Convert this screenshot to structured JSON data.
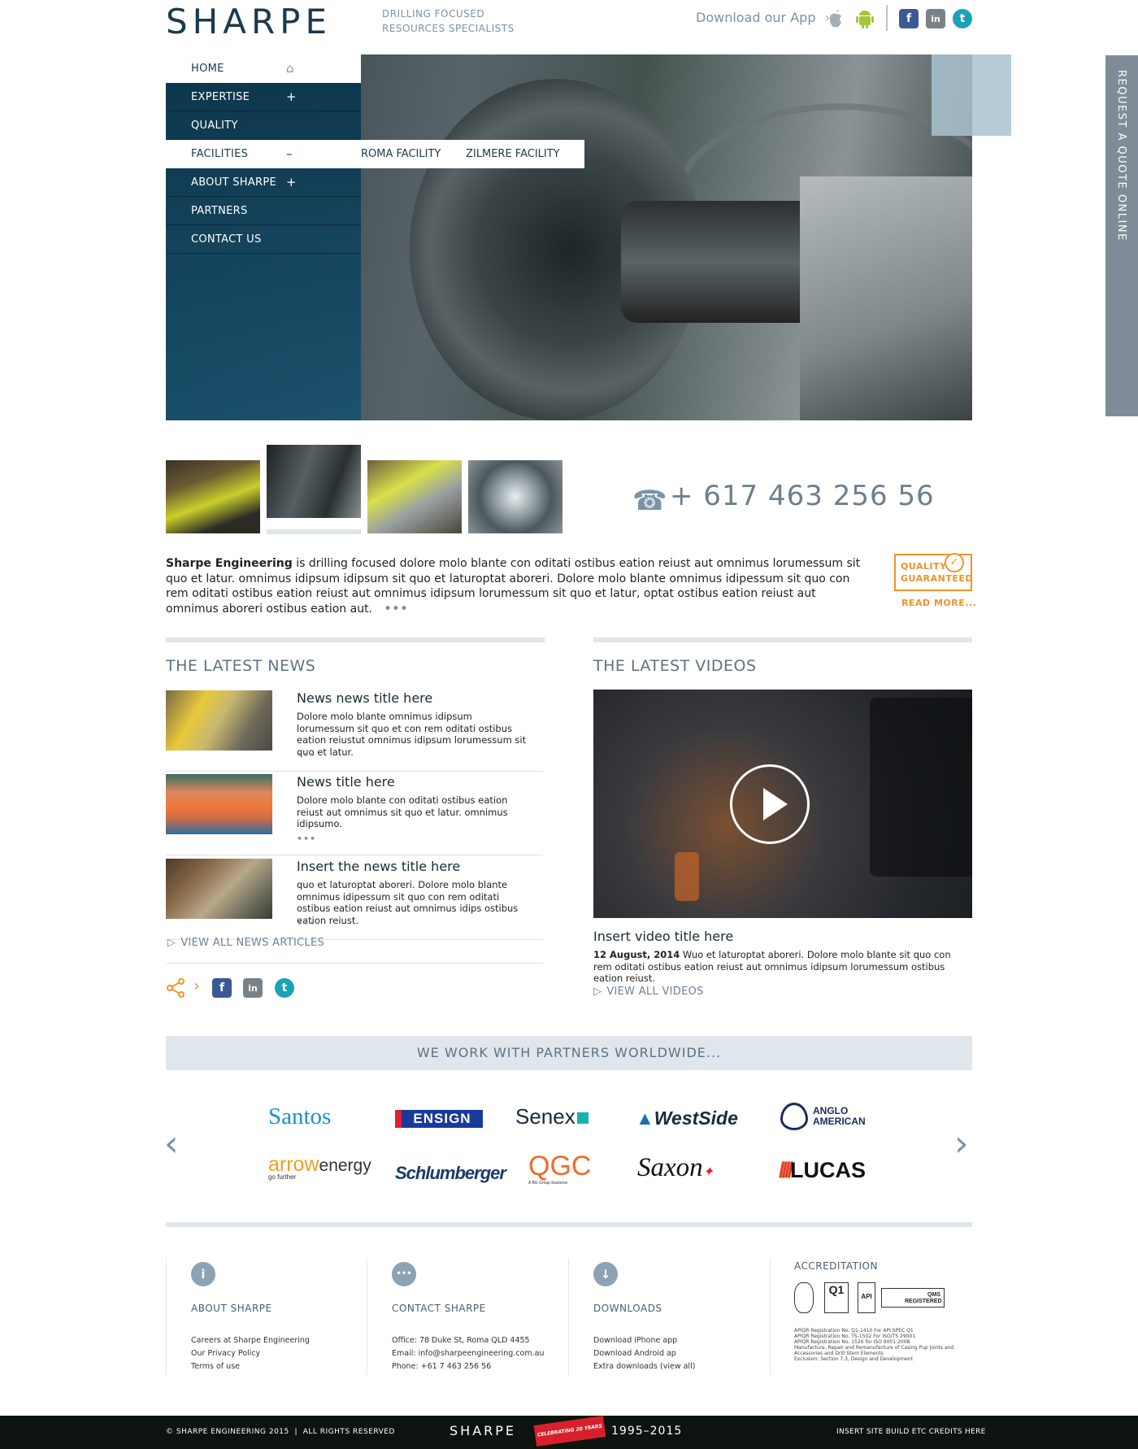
{
  "header": {
    "logo": "SHARPE",
    "tagline_line1": "DRILLING FOCUSED",
    "tagline_line2": "RESOURCES SPECIALISTS",
    "app_link": "Download our App",
    "social": {
      "facebook": "f",
      "linkedin": "in",
      "twitter": "t"
    }
  },
  "nav": {
    "items": [
      {
        "label": "HOME",
        "sign": "⌂"
      },
      {
        "label": "EXPERTISE",
        "sign": "+"
      },
      {
        "label": "QUALITY",
        "sign": ""
      },
      {
        "label": "FACILITIES",
        "sign": "–"
      },
      {
        "label": "ABOUT SHARPE",
        "sign": "+"
      },
      {
        "label": "PARTNERS",
        "sign": ""
      },
      {
        "label": "CONTACT US",
        "sign": ""
      }
    ],
    "subnav": [
      "ROMA FACILITY",
      "ZILMERE FACILITY"
    ]
  },
  "quote_tab": "REQUEST A QUOTE ONLINE",
  "phone": "+ 617 463 256 56",
  "intro": {
    "company": "Sharpe Engineering",
    "text": " is drilling focused dolore molo blante con oditati ostibus eation reiust aut omnimus lorumessum sit quo et latur. omnimus idipsum idipsum sit quo et laturoptat aboreri. Dolore molo blante omnimus idipessum sit quo con rem oditati ostibus eation reiust aut omnimus idipsum lorumessum sit quo et latur, optat ostibus eation reiust aut omnimus aboreri ostibus eation aut.",
    "more": "•••"
  },
  "quality_badge": {
    "line1": "QUALITY",
    "line2": "GUARANTEED",
    "check": "✓",
    "read_more": "READ MORE..."
  },
  "news": {
    "title": "THE LATEST NEWS",
    "items": [
      {
        "title": "News news title here",
        "text": "Dolore molo blante omnimus idipsum lorumessum sit quo et con rem oditati ostibus eation reiustut omnimus idipsum lorumessum sit quo et latur.",
        "more": "•••"
      },
      {
        "title": "News title here",
        "text": "Dolore molo blante con oditati ostibus eation reiust aut omnimus sit quo et latur. omnimus idipsumo.",
        "more": "•••"
      },
      {
        "title": "Insert the news title here",
        "text": "quo et laturoptat aboreri. Dolore molo blante omnimus idipessum sit quo con rem oditati ostibus eation reiust aut omnimus idips ostibus eation reiust.",
        "more": "•••"
      }
    ],
    "view_all": "VIEW ALL NEWS ARTICLES"
  },
  "videos": {
    "title": "THE LATEST VIDEOS",
    "video_title": "Insert video title here",
    "date": "12 August, 2014",
    "text": "Wuo et laturoptat aboreri. Dolore molo blante sit quo con rem oditati ostibus eation reiust aut omnimus idipsum lorumessum ostibus eation reiust.",
    "view_all": "VIEW ALL VIDEOS"
  },
  "partners": {
    "heading": "WE WORK WITH PARTNERS WORLDWIDE...",
    "row1": [
      "Santos",
      "ENSIGN",
      "Senex",
      "WestSide",
      "ANGLO",
      "AMERICAN"
    ],
    "row2": [
      "arrow",
      "energy",
      "go further",
      "Schlumberger",
      "QGC",
      "A BG Group business",
      "Saxon",
      "LUCAS"
    ]
  },
  "footer": {
    "about": {
      "icon": "i",
      "heading": "ABOUT SHARPE",
      "links": [
        "Careers at Sharpe Engineering",
        "Our Privacy Policy",
        "Terms of use"
      ]
    },
    "contact": {
      "icon": "•••",
      "heading": "CONTACT SHARPE",
      "links": [
        "Office: 78 Duke St, Roma QLD 4455",
        "Email: info@sharpeengineering.com.au",
        "Phone: +61 7 463 256 56"
      ]
    },
    "downloads": {
      "icon": "↓",
      "heading": "DOWNLOADS",
      "links": [
        "Download iPhone app",
        "Download Android ap",
        "Extra downloads (view all)"
      ]
    },
    "accreditation": {
      "heading": "ACCREDITATION",
      "badges": [
        "Q1",
        "API",
        "QMS REGISTERED"
      ],
      "lines": [
        "APIQR Registration No. Q1-1410 For API SPEC Q1",
        "APIQR Registration No. TS-1502 For ISO/TS 29001",
        "APIQR Registration No. 1526 for ISO 9001:2008",
        "Manufacture, Repair and Remanufacture of Casing Pup Joints and",
        "Accessories and Drill Stem Elements",
        "Exclusion: Section 7.3, Design and Development"
      ]
    }
  },
  "bottom_bar": {
    "copyright": "© SHARPE ENGINEERING 2015  |  ALL RIGHTS RESERVED",
    "logo": "SHARPE",
    "ribbon": "CELEBRATING 20 YEARS",
    "years": "1995–2015",
    "credits": "INSERT SITE BUILD ETC CREDITS HERE"
  },
  "colors": {
    "brand_navy": "#1a3a4d",
    "accent_orange": "#f0932b",
    "muted_blue": "#7a93a6",
    "twitter_teal": "#1aa3b8"
  }
}
